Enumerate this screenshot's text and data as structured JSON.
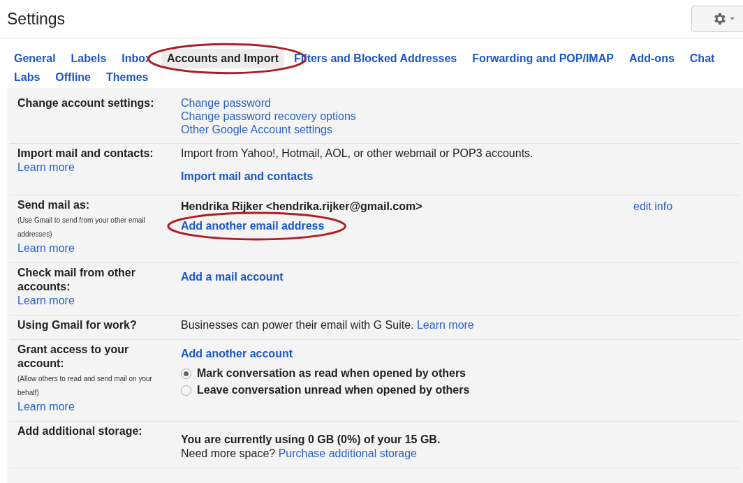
{
  "title": "Settings",
  "tab_rows": [
    [
      {
        "label": "General",
        "selected": false,
        "circled": false
      },
      {
        "label": "Labels",
        "selected": false,
        "circled": false
      },
      {
        "label": "Inbox",
        "selected": false,
        "circled": false
      },
      {
        "label": "Accounts and Import",
        "selected": true,
        "circled": true
      },
      {
        "label": "Filters and Blocked Addresses",
        "selected": false,
        "circled": false
      },
      {
        "label": "Forwarding and POP/IMAP",
        "selected": false,
        "circled": false
      },
      {
        "label": "Add-ons",
        "selected": false,
        "circled": false
      },
      {
        "label": "Chat",
        "selected": false,
        "circled": false
      }
    ],
    [
      {
        "label": "Labs",
        "selected": false,
        "circled": false
      },
      {
        "label": "Offline",
        "selected": false,
        "circled": false
      },
      {
        "label": "Themes",
        "selected": false,
        "circled": false
      }
    ]
  ],
  "sections": [
    {
      "label": "Change account settings:",
      "items": [
        {
          "kind": "plain-link",
          "text": "Change password"
        },
        {
          "kind": "plain-link",
          "text": "Change password recovery options"
        },
        {
          "kind": "plain-link",
          "text": "Other Google Account settings"
        }
      ]
    },
    {
      "label": "Import mail and contacts:",
      "learn_more": "Learn more",
      "items": [
        {
          "kind": "text",
          "text": "Import from Yahoo!, Hotmail, AOL, or other webmail or POP3 accounts."
        },
        {
          "kind": "action-link",
          "text": "Import mail and contacts"
        }
      ]
    },
    {
      "label": "Send mail as:",
      "note": "(Use Gmail to send from your other email addresses)",
      "learn_more": "Learn more",
      "items": [
        {
          "kind": "identity",
          "text": "Hendrika Rijker <hendrika.rijker@gmail.com>",
          "edit": "edit info"
        },
        {
          "kind": "action-link",
          "text": "Add another email address",
          "circled": true
        }
      ]
    },
    {
      "label": "Check mail from other accounts:",
      "learn_more": "Learn more",
      "items": [
        {
          "kind": "action-link",
          "text": "Add a mail account"
        }
      ]
    },
    {
      "label": "Using Gmail for work?",
      "items": [
        {
          "kind": "text-with-link",
          "text": "Businesses can power their email with G Suite.",
          "link": "Learn more"
        }
      ]
    },
    {
      "label": "Grant access to your account:",
      "note": "(Allow others to read and send mail on your behalf)",
      "learn_more": "Learn more",
      "items": [
        {
          "kind": "action-link",
          "text": "Add another account"
        },
        {
          "kind": "radio",
          "text": "Mark conversation as read when opened by others",
          "selected": true
        },
        {
          "kind": "radio",
          "text": "Leave conversation unread when opened by others",
          "selected": false
        }
      ]
    },
    {
      "label": "Add additional storage:",
      "items": [
        {
          "kind": "bold-text",
          "text": "You are currently using 0 GB (0%) of your 15 GB."
        },
        {
          "kind": "text-with-link",
          "text": "Need more space?",
          "link": "Purchase additional storage"
        }
      ]
    }
  ]
}
